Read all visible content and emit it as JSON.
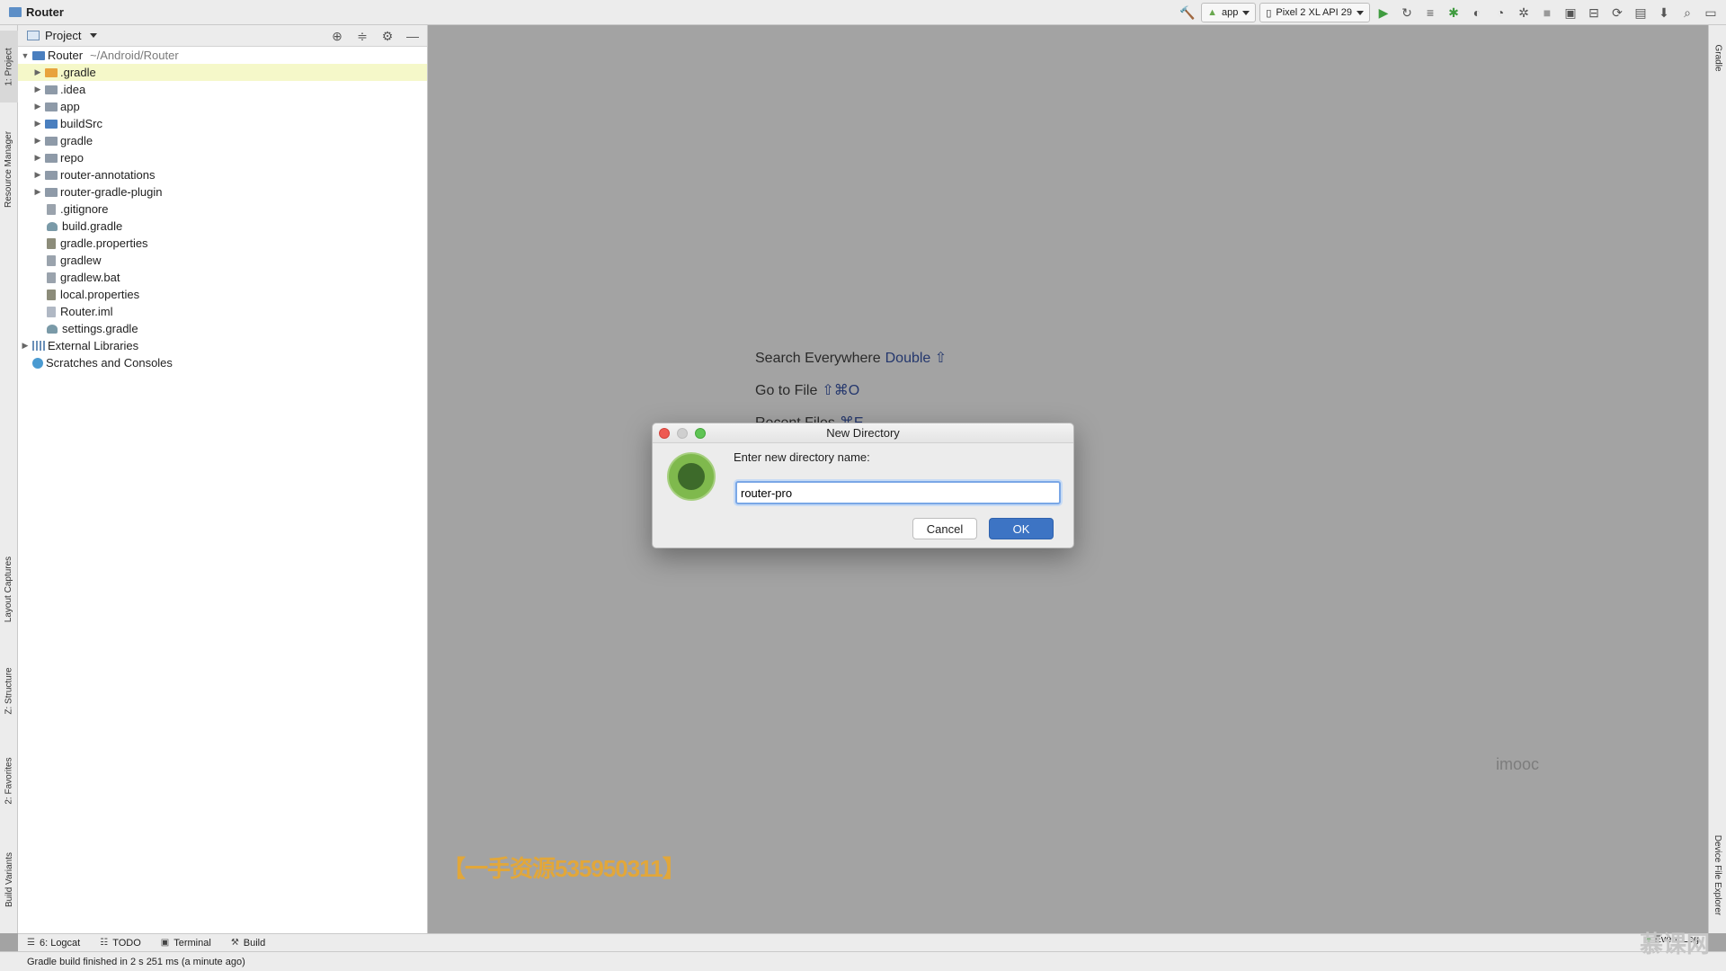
{
  "window": {
    "project_title": "Router"
  },
  "toolbar": {
    "config": "app",
    "device": "Pixel 2 XL API 29"
  },
  "left_strip": {
    "tabs": [
      "1: Project",
      "Resource Manager",
      "Layout Captures",
      "Z: Structure",
      "2: Favorites",
      "Build Variants"
    ]
  },
  "right_strip": {
    "tabs": [
      "Gradle",
      "Device File Explorer"
    ]
  },
  "project_panel": {
    "view_label": "Project",
    "root": {
      "name": "Router",
      "path": "~/Android/Router"
    },
    "items": [
      {
        "label": ".gradle",
        "kind": "folder-orange",
        "expandable": true,
        "selected": true
      },
      {
        "label": ".idea",
        "kind": "folder",
        "expandable": true
      },
      {
        "label": "app",
        "kind": "folder",
        "expandable": true
      },
      {
        "label": "buildSrc",
        "kind": "folder-blue",
        "expandable": true
      },
      {
        "label": "gradle",
        "kind": "folder",
        "expandable": true
      },
      {
        "label": "repo",
        "kind": "folder",
        "expandable": true
      },
      {
        "label": "router-annotations",
        "kind": "folder",
        "expandable": true
      },
      {
        "label": "router-gradle-plugin",
        "kind": "folder",
        "expandable": true
      },
      {
        "label": ".gitignore",
        "kind": "file"
      },
      {
        "label": "build.gradle",
        "kind": "gradle"
      },
      {
        "label": "gradle.properties",
        "kind": "props"
      },
      {
        "label": "gradlew",
        "kind": "file"
      },
      {
        "label": "gradlew.bat",
        "kind": "file"
      },
      {
        "label": "local.properties",
        "kind": "props"
      },
      {
        "label": "Router.iml",
        "kind": "iml"
      },
      {
        "label": "settings.gradle",
        "kind": "gradle"
      }
    ],
    "external_libraries": "External Libraries",
    "scratches": "Scratches and Consoles"
  },
  "editor": {
    "hints": [
      {
        "text": "Search Everywhere",
        "key": "Double ⇧"
      },
      {
        "text": "Go to File",
        "key": "⇧⌘O"
      },
      {
        "text": "Recent Files",
        "key": "⌘E"
      }
    ],
    "watermark_imooc": "imooc",
    "watermark_text": "【一手资源535950311】"
  },
  "dialog": {
    "title": "New Directory",
    "prompt": "Enter new directory name:",
    "input_value": "router-pro",
    "cancel": "Cancel",
    "ok": "OK"
  },
  "bottom_tabs": [
    "6: Logcat",
    "TODO",
    "Terminal",
    "Build"
  ],
  "event_log": "Event Log",
  "status": "Gradle build finished in 2 s 251 ms (a minute ago)",
  "corner_watermark": "慕课网"
}
